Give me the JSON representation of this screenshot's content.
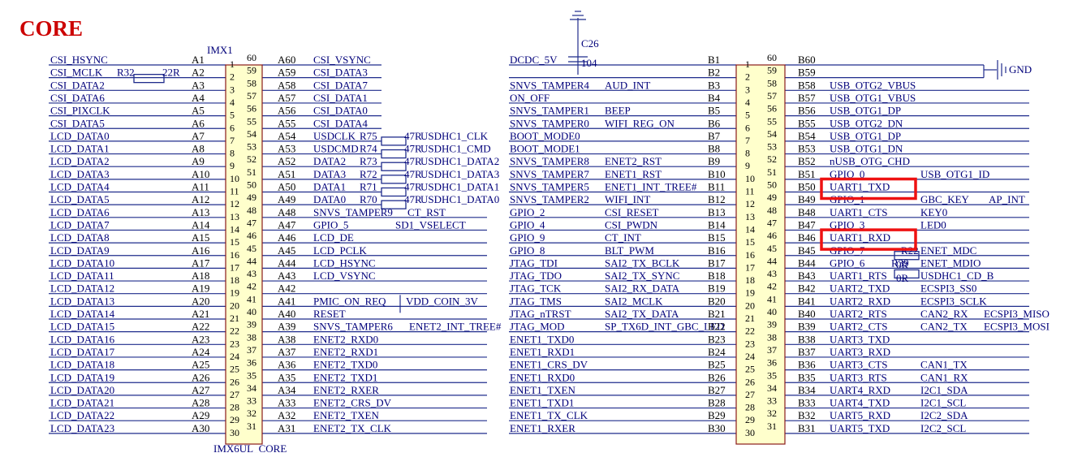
{
  "title": "CORE",
  "chip_designator": "IMX1",
  "chip_name": "IMX6UL_CORE",
  "cap": {
    "name": "C26",
    "value": "104"
  },
  "left": [
    {
      "net": "CSI_HSYNC",
      "pin": "A1",
      "p1": "1",
      "p2": "60",
      "apin": "A60",
      "anet": "CSI_VSYNC"
    },
    {
      "net": "CSI_MCLK",
      "pin": "A2",
      "p1": "2",
      "p2": "59",
      "apin": "A59",
      "anet": "CSI_DATA3"
    },
    {
      "net": "CSI_DATA2",
      "pin": "A3",
      "p1": "3",
      "p2": "58",
      "apin": "A58",
      "anet": "CSI_DATA7"
    },
    {
      "net": "CSI_DATA6",
      "pin": "A4",
      "p1": "4",
      "p2": "57",
      "apin": "A57",
      "anet": "CSI_DATA1"
    },
    {
      "net": "CSI_PIXCLK",
      "pin": "A5",
      "p1": "5",
      "p2": "56",
      "apin": "A56",
      "anet": "CSI_DATA0"
    },
    {
      "net": "CSI_DATA5",
      "pin": "A6",
      "p1": "6",
      "p2": "55",
      "apin": "A55",
      "anet": "CSI_DATA4"
    },
    {
      "net": "LCD_DATA0",
      "pin": "A7",
      "p1": "7",
      "p2": "54",
      "apin": "A54",
      "anet": "USDCLK"
    },
    {
      "net": "LCD_DATA1",
      "pin": "A8",
      "p1": "8",
      "p2": "53",
      "apin": "A53",
      "anet": "USDCMD"
    },
    {
      "net": "LCD_DATA2",
      "pin": "A9",
      "p1": "9",
      "p2": "52",
      "apin": "A52",
      "anet": "DATA2"
    },
    {
      "net": "LCD_DATA3",
      "pin": "A10",
      "p1": "10",
      "p2": "51",
      "apin": "A51",
      "anet": "DATA3"
    },
    {
      "net": "LCD_DATA4",
      "pin": "A11",
      "p1": "11",
      "p2": "50",
      "apin": "A50",
      "anet": "DATA1"
    },
    {
      "net": "LCD_DATA5",
      "pin": "A12",
      "p1": "12",
      "p2": "49",
      "apin": "A49",
      "anet": "DATA0"
    },
    {
      "net": "LCD_DATA6",
      "pin": "A13",
      "p1": "13",
      "p2": "48",
      "apin": "A48",
      "anet": "SNVS_TAMPER9"
    },
    {
      "net": "LCD_DATA7",
      "pin": "A14",
      "p1": "14",
      "p2": "47",
      "apin": "A47",
      "anet": "GPIO_5"
    },
    {
      "net": "LCD_DATA8",
      "pin": "A15",
      "p1": "15",
      "p2": "46",
      "apin": "A46",
      "anet": "LCD_DE"
    },
    {
      "net": "LCD_DATA9",
      "pin": "A16",
      "p1": "16",
      "p2": "45",
      "apin": "A45",
      "anet": "LCD_PCLK"
    },
    {
      "net": "LCD_DATA10",
      "pin": "A17",
      "p1": "17",
      "p2": "44",
      "apin": "A44",
      "anet": "LCD_HSYNC"
    },
    {
      "net": "LCD_DATA11",
      "pin": "A18",
      "p1": "18",
      "p2": "43",
      "apin": "A43",
      "anet": "LCD_VSYNC"
    },
    {
      "net": "LCD_DATA12",
      "pin": "A19",
      "p1": "19",
      "p2": "42",
      "apin": "A42",
      "anet": ""
    },
    {
      "net": "LCD_DATA13",
      "pin": "A20",
      "p1": "20",
      "p2": "41",
      "apin": "A41",
      "anet": "PMIC_ON_REQ"
    },
    {
      "net": "LCD_DATA14",
      "pin": "A21",
      "p1": "21",
      "p2": "40",
      "apin": "A40",
      "anet": "RESET"
    },
    {
      "net": "LCD_DATA15",
      "pin": "A22",
      "p1": "22",
      "p2": "39",
      "apin": "A39",
      "anet": "SNVS_TAMPER6"
    },
    {
      "net": "LCD_DATA16",
      "pin": "A23",
      "p1": "23",
      "p2": "38",
      "apin": "A38",
      "anet": "ENET2_RXD0"
    },
    {
      "net": "LCD_DATA17",
      "pin": "A24",
      "p1": "24",
      "p2": "37",
      "apin": "A37",
      "anet": "ENET2_RXD1"
    },
    {
      "net": "LCD_DATA18",
      "pin": "A25",
      "p1": "25",
      "p2": "36",
      "apin": "A36",
      "anet": "ENET2_TXD0"
    },
    {
      "net": "LCD_DATA19",
      "pin": "A26",
      "p1": "26",
      "p2": "35",
      "apin": "A35",
      "anet": "ENET2_TXD1"
    },
    {
      "net": "LCD_DATA20",
      "pin": "A27",
      "p1": "27",
      "p2": "34",
      "apin": "A34",
      "anet": "ENET2_RXER"
    },
    {
      "net": "LCD_DATA21",
      "pin": "A28",
      "p1": "28",
      "p2": "33",
      "apin": "A33",
      "anet": "ENET2_CRS_DV"
    },
    {
      "net": "LCD_DATA22",
      "pin": "A29",
      "p1": "29",
      "p2": "32",
      "apin": "A32",
      "anet": "ENET2_TXEN"
    },
    {
      "net": "LCD_DATA23",
      "pin": "A30",
      "p1": "30",
      "p2": "31",
      "apin": "A31",
      "anet": "ENET2_TX_CLK"
    }
  ],
  "sd_resistors": [
    {
      "row": 6,
      "ref": "R75",
      "val": "47R",
      "net": "USDHC1_CLK"
    },
    {
      "row": 7,
      "ref": "R74",
      "val": "47R",
      "net": "USDHC1_CMD"
    },
    {
      "row": 8,
      "ref": "R73",
      "val": "47R",
      "net": "USDHC1_DATA2"
    },
    {
      "row": 9,
      "ref": "R72",
      "val": "47R",
      "net": "USDHC1_DATA3"
    },
    {
      "row": 10,
      "ref": "R71",
      "val": "47R",
      "net": "USDHC1_DATA1"
    },
    {
      "row": 11,
      "ref": "R70",
      "val": "47R",
      "net": "USDHC1_DATA0"
    }
  ],
  "left_extras": {
    "r32_ref": "R32",
    "r32_val": "22R",
    "ct_rst": "CT_RST",
    "sd1_vselect": "SD1_VSELECT",
    "vdd_coin": "VDD_COIN_3V",
    "enet2_int": "ENET2_INT_TREE#"
  },
  "right": [
    {
      "lnet": "DCDC_5V",
      "lfunc": "",
      "bpin": "B1",
      "p1": "1",
      "p2": "60",
      "rpin": "B60",
      "rnet": "",
      "rfunc": ""
    },
    {
      "lnet": "",
      "lfunc": "",
      "bpin": "B2",
      "p1": "2",
      "p2": "59",
      "rpin": "B59",
      "rnet": "",
      "rfunc": ""
    },
    {
      "lnet": "SNVS_TAMPER4",
      "lfunc": "AUD_INT",
      "bpin": "B3",
      "p1": "3",
      "p2": "58",
      "rpin": "B58",
      "rnet": "USB_OTG2_VBUS",
      "rfunc": ""
    },
    {
      "lnet": "ON_OFF",
      "lfunc": "",
      "bpin": "B4",
      "p1": "4",
      "p2": "57",
      "rpin": "B57",
      "rnet": "USB_OTG1_VBUS",
      "rfunc": ""
    },
    {
      "lnet": "SNVS_TAMPER1",
      "lfunc": "BEEP",
      "bpin": "B5",
      "p1": "5",
      "p2": "56",
      "rpin": "B56",
      "rnet": "USB_OTG1_DP",
      "rfunc": ""
    },
    {
      "lnet": "SNVS_TAMPER0",
      "lfunc": "WIFI_REG_ON",
      "bpin": "B6",
      "p1": "6",
      "p2": "55",
      "rpin": "B55",
      "rnet": "USB_OTG2_DN",
      "rfunc": ""
    },
    {
      "lnet": "BOOT_MODE0",
      "lfunc": "",
      "bpin": "B7",
      "p1": "7",
      "p2": "54",
      "rpin": "B54",
      "rnet": "USB_OTG1_DP",
      "rfunc": ""
    },
    {
      "lnet": "BOOT_MODE1",
      "lfunc": "",
      "bpin": "B8",
      "p1": "8",
      "p2": "53",
      "rpin": "B53",
      "rnet": "USB_OTG1_DN",
      "rfunc": ""
    },
    {
      "lnet": "SNVS_TAMPER8",
      "lfunc": "ENET2_RST",
      "bpin": "B9",
      "p1": "9",
      "p2": "52",
      "rpin": "B52",
      "rnet": "nUSB_OTG_CHD",
      "rfunc": ""
    },
    {
      "lnet": "SNVS_TAMPER7",
      "lfunc": "ENET1_RST",
      "bpin": "B10",
      "p1": "10",
      "p2": "51",
      "rpin": "B51",
      "rnet": "GPIO_0",
      "rfunc": "USB_OTG1_ID"
    },
    {
      "lnet": "SNVS_TAMPER5",
      "lfunc": "ENET1_INT_TREE#",
      "bpin": "B11",
      "p1": "11",
      "p2": "50",
      "rpin": "B50",
      "rnet": "UART1_TXD",
      "rfunc": ""
    },
    {
      "lnet": "SNVS_TAMPER2",
      "lfunc": "WIFI_INT",
      "bpin": "B12",
      "p1": "12",
      "p2": "49",
      "rpin": "B49",
      "rnet": "GPIO_1",
      "rfunc": "GBC_KEY"
    },
    {
      "lnet": "GPIO_2",
      "lfunc": "CSI_RESET",
      "bpin": "B13",
      "p1": "13",
      "p2": "48",
      "rpin": "B48",
      "rnet": "UART1_CTS",
      "rfunc": "KEY0"
    },
    {
      "lnet": "GPIO_4",
      "lfunc": "CSI_PWDN",
      "bpin": "B14",
      "p1": "14",
      "p2": "47",
      "rpin": "B47",
      "rnet": "GPIO_3",
      "rfunc": "LED0"
    },
    {
      "lnet": "GPIO_9",
      "lfunc": "CT_INT",
      "bpin": "B15",
      "p1": "15",
      "p2": "46",
      "rpin": "B46",
      "rnet": "UART1_RXD",
      "rfunc": ""
    },
    {
      "lnet": "GPIO_8",
      "lfunc": "BLT_PWM",
      "bpin": "B16",
      "p1": "16",
      "p2": "45",
      "rpin": "B45",
      "rnet": "GPIO_7",
      "rfunc": "ENET_MDC"
    },
    {
      "lnet": "JTAG_TDI",
      "lfunc": "SAI2_TX_BCLK",
      "bpin": "B17",
      "p1": "17",
      "p2": "44",
      "rpin": "B44",
      "rnet": "GPIO_6",
      "rfunc": "ENET_MDIO"
    },
    {
      "lnet": "JTAG_TDO",
      "lfunc": "SAI2_TX_SYNC",
      "bpin": "B18",
      "p1": "18",
      "p2": "43",
      "rpin": "B43",
      "rnet": "UART1_RTS",
      "rfunc": "USDHC1_CD_B"
    },
    {
      "lnet": "JTAG_TCK",
      "lfunc": "SAI2_RX_DATA",
      "bpin": "B19",
      "p1": "19",
      "p2": "42",
      "rpin": "B42",
      "rnet": "UART2_TXD",
      "rfunc": "ECSPI3_SS0"
    },
    {
      "lnet": "JTAG_TMS",
      "lfunc": "SAI2_MCLK",
      "bpin": "B20",
      "p1": "20",
      "p2": "41",
      "rpin": "B41",
      "rnet": "UART2_RXD",
      "rfunc": "ECSPI3_SCLK"
    },
    {
      "lnet": "JTAG_nTRST",
      "lfunc": "SAI2_TX_DATA",
      "bpin": "B21",
      "p1": "21",
      "p2": "40",
      "rpin": "B40",
      "rnet": "UART2_RTS",
      "rfunc": "CAN2_RX"
    },
    {
      "lnet": "JTAG_MOD",
      "lfunc": "SP_TX6D_INT_GBC_LED",
      "bpin": "B22",
      "p1": "22",
      "p2": "39",
      "rpin": "B39",
      "rnet": "UART2_CTS",
      "rfunc": "CAN2_TX"
    },
    {
      "lnet": "ENET1_TXD0",
      "lfunc": "",
      "bpin": "B23",
      "p1": "23",
      "p2": "38",
      "rpin": "B38",
      "rnet": "UART3_TXD",
      "rfunc": ""
    },
    {
      "lnet": "ENET1_RXD1",
      "lfunc": "",
      "bpin": "B24",
      "p1": "24",
      "p2": "37",
      "rpin": "B37",
      "rnet": "UART3_RXD",
      "rfunc": ""
    },
    {
      "lnet": "ENET1_CRS_DV",
      "lfunc": "",
      "bpin": "B25",
      "p1": "25",
      "p2": "36",
      "rpin": "B36",
      "rnet": "UART3_CTS",
      "rfunc": "CAN1_TX"
    },
    {
      "lnet": "ENET1_RXD0",
      "lfunc": "",
      "bpin": "B26",
      "p1": "26",
      "p2": "35",
      "rpin": "B35",
      "rnet": "UART3_RTS",
      "rfunc": "CAN1_RX"
    },
    {
      "lnet": "ENET1_TXEN",
      "lfunc": "",
      "bpin": "B27",
      "p1": "27",
      "p2": "34",
      "rpin": "B34",
      "rnet": "UART4_RXD",
      "rfunc": "I2C1_SDA"
    },
    {
      "lnet": "ENET1_TXD1",
      "lfunc": "",
      "bpin": "B28",
      "p1": "28",
      "p2": "33",
      "rpin": "B33",
      "rnet": "UART4_TXD",
      "rfunc": "I2C1_SCL"
    },
    {
      "lnet": "ENET1_TX_CLK",
      "lfunc": "",
      "bpin": "B29",
      "p1": "29",
      "p2": "32",
      "rpin": "B32",
      "rnet": "UART5_RXD",
      "rfunc": "I2C2_SDA"
    },
    {
      "lnet": "ENET1_RXER",
      "lfunc": "",
      "bpin": "B30",
      "p1": "30",
      "p2": "31",
      "rpin": "B31",
      "rnet": "UART5_TXD",
      "rfunc": "I2C2_SCL"
    }
  ],
  "right_extras": {
    "gnd": "GND",
    "ap_int": "AP_INT",
    "r22_ref": "R22",
    "r39_ref": "R39",
    "r_val": "0R",
    "ecspi3_miso": "ECSPI3_MISO",
    "ecspi3_mosi": "ECSPI3_MOSI"
  },
  "highlights": [
    "UART1_TXD",
    "UART1_RXD"
  ],
  "colors": {
    "wire": "#1f2c8c",
    "highlight": "#ee1111",
    "title": "#cc0000"
  }
}
